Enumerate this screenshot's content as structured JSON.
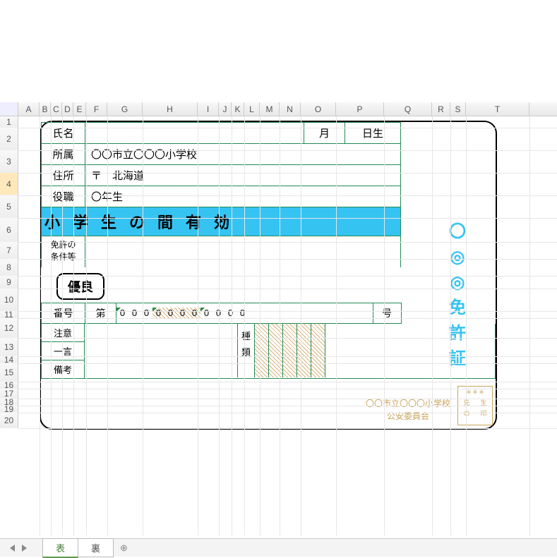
{
  "columns": [
    {
      "l": "A",
      "w": 30
    },
    {
      "l": "B",
      "w": 16
    },
    {
      "l": "C",
      "w": 16
    },
    {
      "l": "D",
      "w": 16
    },
    {
      "l": "E",
      "w": 18
    },
    {
      "l": "F",
      "w": 30
    },
    {
      "l": "G",
      "w": 50
    },
    {
      "l": "H",
      "w": 78
    },
    {
      "l": "I",
      "w": 30
    },
    {
      "l": "J",
      "w": 18
    },
    {
      "l": "K",
      "w": 18
    },
    {
      "l": "L",
      "w": 22
    },
    {
      "l": "M",
      "w": 28
    },
    {
      "l": "N",
      "w": 30
    },
    {
      "l": "O",
      "w": 50
    },
    {
      "l": "P",
      "w": 68
    },
    {
      "l": "Q",
      "w": 68
    },
    {
      "l": "R",
      "w": 26
    },
    {
      "l": "S",
      "w": 22
    },
    {
      "l": "T",
      "w": 90
    }
  ],
  "rows": [
    {
      "n": 1,
      "h": 16
    },
    {
      "n": 2,
      "h": 32
    },
    {
      "n": 3,
      "h": 32
    },
    {
      "n": 4,
      "h": 32
    },
    {
      "n": 5,
      "h": 32
    },
    {
      "n": 6,
      "h": 34
    },
    {
      "n": 7,
      "h": 24
    },
    {
      "n": 8,
      "h": 24
    },
    {
      "n": 9,
      "h": 18
    },
    {
      "n": 10,
      "h": 32
    },
    {
      "n": 11,
      "h": 10
    },
    {
      "n": 12,
      "h": 28
    },
    {
      "n": 13,
      "h": 26
    },
    {
      "n": 14,
      "h": 10
    },
    {
      "n": 15,
      "h": 26
    },
    {
      "n": 16,
      "h": 10
    },
    {
      "n": 17,
      "h": 14
    },
    {
      "n": 18,
      "h": 10
    },
    {
      "n": 19,
      "h": 10
    },
    {
      "n": 20,
      "h": 22
    }
  ],
  "selected_row": 4,
  "card": {
    "labels": {
      "name": "氏名",
      "affiliation": "所属",
      "address": "住所",
      "position": "役職",
      "month": "月",
      "born_suffix": "日生",
      "valid_banner": "小学生の間有効",
      "conditions1": "免許の",
      "conditions2": "条件等",
      "excellent": "優良",
      "number": "番号",
      "dai": "第",
      "gou": "号",
      "attention": "注意",
      "one_word": "一言",
      "remarks": "備考",
      "type1": "種",
      "type2": "類"
    },
    "values": {
      "affiliation": "〇〇市立〇〇〇小学校",
      "address": "〒　北海道",
      "position": "〇年生"
    },
    "number_digits": [
      "0",
      "0",
      "0",
      "0",
      "0",
      "0",
      "0",
      "0",
      "0",
      "0",
      "0"
    ],
    "vert_license": "〇◎◎免許証",
    "committee_line1": "〇〇市立〇〇〇小学校",
    "committee_line2": "公安委員会",
    "stamp": {
      "stars": "＊＊＊",
      "r1a": "先",
      "r1b": "生",
      "r2a": "の",
      "r2b": "印"
    }
  },
  "tabs": {
    "front": "表",
    "back": "裏",
    "add": "⊕"
  }
}
